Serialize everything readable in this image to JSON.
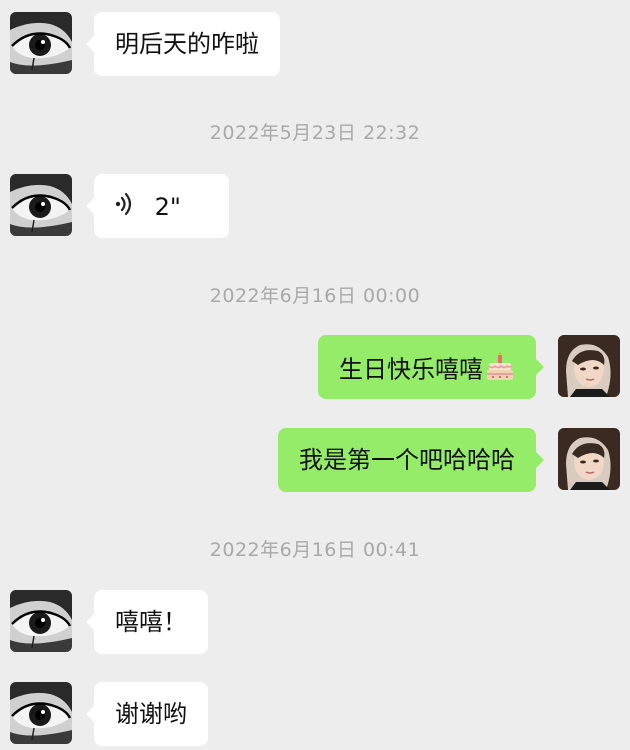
{
  "messages": [
    {
      "kind": "text",
      "side": "in",
      "text": "明后天的咋啦"
    },
    {
      "kind": "timestamp",
      "text": "2022年5月23日 22:32"
    },
    {
      "kind": "voice",
      "side": "in",
      "duration": "2\""
    },
    {
      "kind": "timestamp",
      "text": "2022年6月16日 00:00"
    },
    {
      "kind": "text",
      "side": "out",
      "text": "生日快乐嘻嘻",
      "emoji": "cake-icon"
    },
    {
      "kind": "text",
      "side": "out",
      "text": "我是第一个吧哈哈哈"
    },
    {
      "kind": "timestamp",
      "text": "2022年6月16日 00:41"
    },
    {
      "kind": "text",
      "side": "in",
      "text": "嘻嘻！"
    },
    {
      "kind": "text",
      "side": "in",
      "text": "谢谢哟"
    }
  ],
  "avatars": {
    "contact": "eye-avatar",
    "self": "selfie-avatar"
  },
  "colors": {
    "background": "#ededed",
    "incoming_bubble": "#ffffff",
    "outgoing_bubble": "#95ec69",
    "timestamp": "#a9a9a9"
  }
}
